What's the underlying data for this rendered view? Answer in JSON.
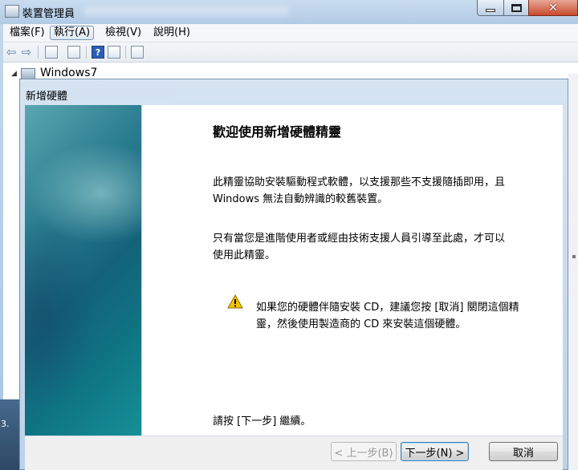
{
  "window": {
    "title": "裝置管理員",
    "min_symbol": "",
    "max_symbol": "",
    "close_symbol": "✕"
  },
  "menubar": {
    "items": [
      "檔案(F)",
      "執行(A)",
      "檢視(V)",
      "說明(H)"
    ],
    "active_index": 1
  },
  "toolbar": {
    "icons": [
      "back-arrow-icon",
      "forward-arrow-icon",
      "properties-icon",
      "update-icon",
      "help-icon",
      "view-icon",
      "scan-hardware-icon"
    ],
    "back_glyph": "⇦",
    "forward_glyph": "⇨",
    "help_glyph": "?"
  },
  "tree": {
    "expander": "◢",
    "root_label": "Windows7"
  },
  "taskbar_fragment": "3.",
  "wizard": {
    "title": "新增硬體",
    "heading": "歡迎使用新增硬體精靈",
    "paragraph1_line1": "此精靈協助安裝驅動程式軟體，以支援那些不支援隨插即用，且",
    "paragraph1_line2": "Windows 無法自動辨識的較舊裝置。",
    "paragraph2_line1": "只有當您是進階使用者或經由技術支援人員引導至此處，才可以",
    "paragraph2_line2": "使用此精靈。",
    "warning_line1": "如果您的硬體伴隨安裝 CD，建議您按 [取消] 關閉這個精",
    "warning_line2": "靈，然後使用製造商的 CD 來安裝這個硬體。",
    "continue_text": "請按 [下一步] 繼續。",
    "buttons": {
      "back": "< 上一步(B)",
      "next": "下一步(N) >",
      "cancel": "取消"
    },
    "colors": {
      "banner_dark": "#13627a",
      "banner_light": "#5aa7b2",
      "warning_yellow": "#f5c400"
    }
  }
}
